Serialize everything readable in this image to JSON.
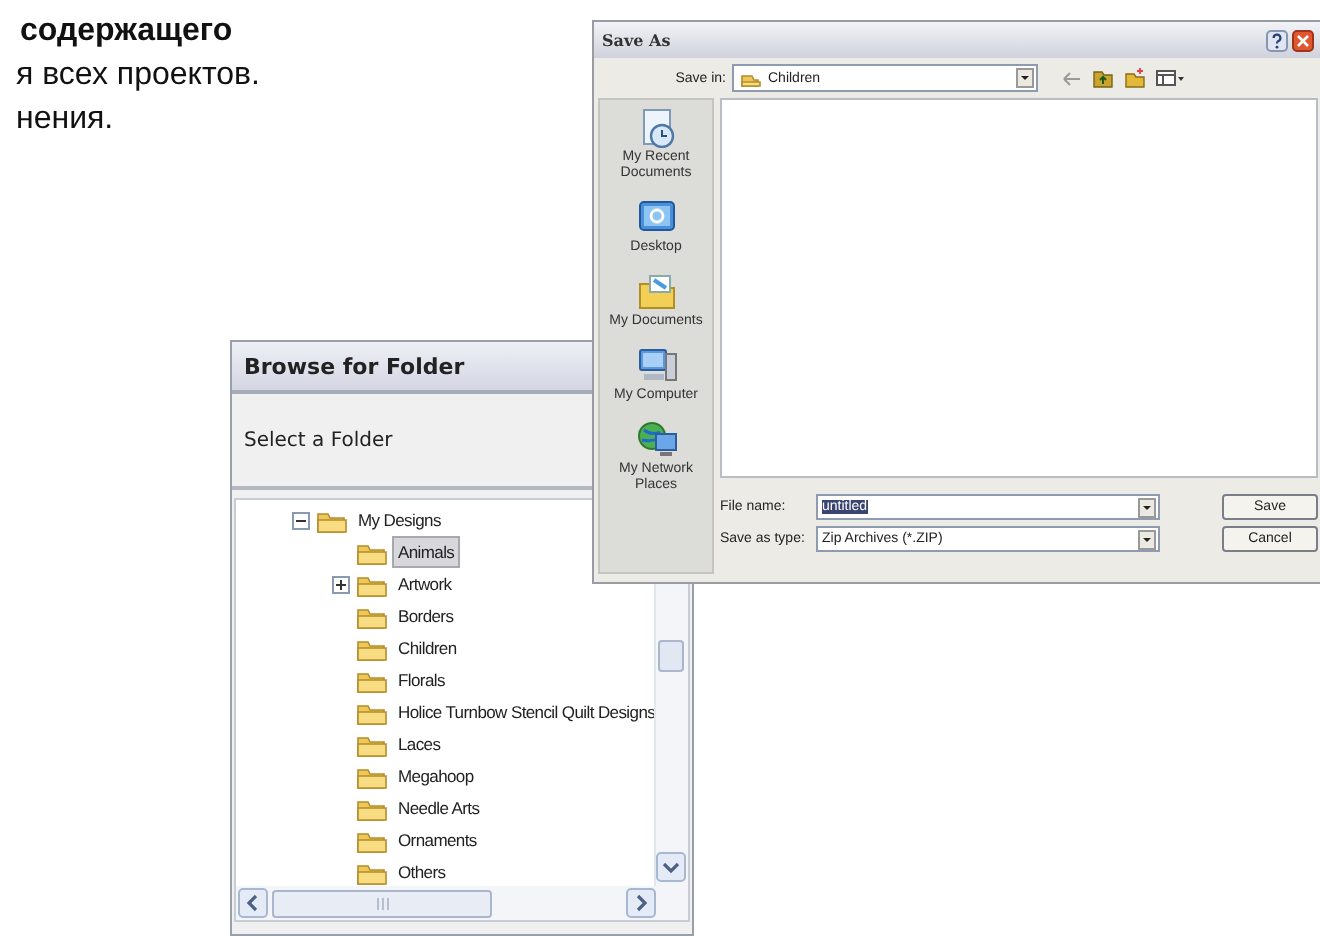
{
  "document_text": {
    "lines": [
      {
        "text": "содержащего",
        "bold": true
      },
      {
        "text": "я всех проектов.",
        "bold": false
      },
      {
        "text": "нения.",
        "bold": false
      }
    ]
  },
  "browse_dialog": {
    "title": "Browse for Folder",
    "prompt": "Select a Folder",
    "tree": [
      {
        "label": "My Designs",
        "expandable": true,
        "expanded": true,
        "selected": false,
        "children": [
          {
            "label": "Animals",
            "expandable": false,
            "selected": true
          },
          {
            "label": "Artwork",
            "expandable": true,
            "expanded": false,
            "selected": false
          },
          {
            "label": "Borders",
            "expandable": false,
            "selected": false
          },
          {
            "label": "Children",
            "expandable": false,
            "selected": false
          },
          {
            "label": "Florals",
            "expandable": false,
            "selected": false
          },
          {
            "label": "Holice Turnbow Stencil Quilt Designs",
            "expandable": false,
            "selected": false
          },
          {
            "label": "Laces",
            "expandable": false,
            "selected": false
          },
          {
            "label": "Megahoop",
            "expandable": false,
            "selected": false
          },
          {
            "label": "Needle Arts",
            "expandable": false,
            "selected": false
          },
          {
            "label": "Ornaments",
            "expandable": false,
            "selected": false
          },
          {
            "label": "Others",
            "expandable": false,
            "selected": false
          }
        ]
      }
    ]
  },
  "save_dialog": {
    "title": "Save As",
    "save_in": {
      "label": "Save in:",
      "value": "Children"
    },
    "places": [
      {
        "label": "My Recent Documents",
        "kind": "recent"
      },
      {
        "label": "Desktop",
        "kind": "desktop"
      },
      {
        "label": "My Documents",
        "kind": "documents"
      },
      {
        "label": "My Computer",
        "kind": "computer"
      },
      {
        "label": "My Network Places",
        "kind": "network"
      }
    ],
    "file_name": {
      "label": "File name:",
      "value": "untitled"
    },
    "save_as_type": {
      "label": "Save as type:",
      "value": "Zip Archives (*.ZIP)"
    },
    "buttons": [
      "Save",
      "Cancel"
    ]
  }
}
